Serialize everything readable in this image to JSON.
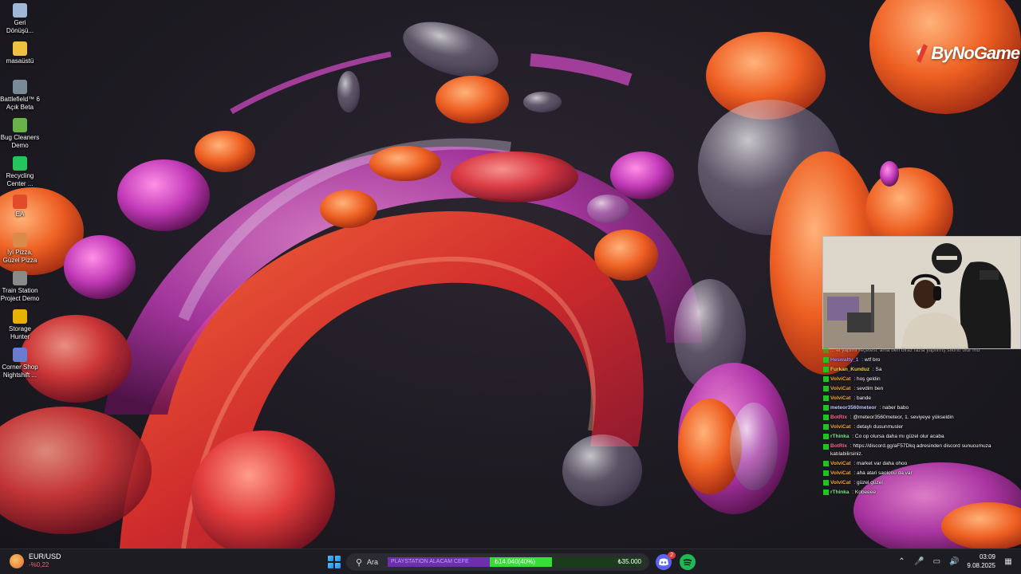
{
  "desktop": {
    "icons": [
      {
        "label": "Geri Dönüşü...",
        "icon": "recycle-bin-icon",
        "color": "#9fb8d8"
      },
      {
        "label": "masaüstü",
        "icon": "folder-icon",
        "color": "#f0c040"
      },
      {
        "label": "Battlefield™ 6 Açık Beta",
        "icon": "battlefield-icon",
        "color": "#7a8a96"
      },
      {
        "label": "Bug Cleaners Demo",
        "icon": "bug-cleaners-icon",
        "color": "#6ab04c"
      },
      {
        "label": "Recycling Center ...",
        "icon": "recycling-center-icon",
        "color": "#22c55e"
      },
      {
        "label": "EA",
        "icon": "ea-icon",
        "color": "#e24b2a"
      },
      {
        "label": "İyi Pizza, Güzel Pizza",
        "icon": "pizza-icon",
        "color": "#d98b4a"
      },
      {
        "label": "Train Station Project Demo",
        "icon": "train-station-icon",
        "color": "#8a8a8a"
      },
      {
        "label": "Storage Hunter",
        "icon": "storage-hunter-icon",
        "color": "#e6b400"
      },
      {
        "label": "Corner Shop Nightshift ...",
        "icon": "corner-shop-icon",
        "color": "#6b7bd0"
      }
    ]
  },
  "brand": {
    "text": "ByNoGame",
    "accent": "#e23b2e"
  },
  "chat": {
    "messages": [
      {
        "user": "",
        "text": "... el yapımı reçetesi. ama ben biraz fazla yapılmış sıkıntı olur mu",
        "color": "#9ad",
        "badge": "#1ec51e",
        "cut": true
      },
      {
        "user": "Heswalty_1",
        "text": "wtf bro",
        "color": "#a78bfa",
        "badge": "#1ec51e"
      },
      {
        "user": "Furkan_Kunduz",
        "text": "Sa",
        "color": "#f5d04a",
        "badge": "#1ec51e"
      },
      {
        "user": "VolviCat",
        "text": "hoş geldin",
        "color": "#f5a623",
        "badge": "#1ec51e"
      },
      {
        "user": "VolviCat",
        "text": "sevdim ben",
        "color": "#f5a623",
        "badge": "#1ec51e"
      },
      {
        "user": "VolviCat",
        "text": "bande",
        "color": "#f5a623",
        "badge": "#1ec51e"
      },
      {
        "user": "meteor3560meteor",
        "text": "naber babo",
        "color": "#b9c7ff",
        "badge": "#1ec51e"
      },
      {
        "user": "BotRix",
        "text": "@meteor3560meteor, 1. seviyeye yükseldin",
        "color": "#f76b8a",
        "badge": "#1ec51e"
      },
      {
        "user": "VolviCat",
        "text": "detaylı dusunmusler",
        "color": "#f5a623",
        "badge": "#1ec51e"
      },
      {
        "user": "rThinka",
        "text": "Co op olursa daha mı güzel olur acaba",
        "color": "#7ee787",
        "badge": "#1ec51e"
      },
      {
        "user": "BotRix",
        "text": "https://discord.gg/aF57Dkq adresinden discord sunucumuza katılabilirsiniz.",
        "color": "#f76b8a",
        "badge": "#1ec51e",
        "wrap": true
      },
      {
        "user": "VolviCat",
        "text": "market var daha ohoo",
        "color": "#f5a623",
        "badge": "#1ec51e"
      },
      {
        "user": "VolviCat",
        "text": "aha atari saolonu da var",
        "color": "#f5a623",
        "badge": "#1ec51e"
      },
      {
        "user": "VolviCat",
        "text": "güzel güzel",
        "color": "#f5a623",
        "badge": "#1ec51e"
      },
      {
        "user": "rThinka",
        "text": "Kobeeee",
        "color": "#7ee787",
        "badge": "#1ec51e"
      }
    ]
  },
  "taskbar": {
    "widget": {
      "title": "EUR/USD",
      "value": "-%0,22",
      "icon": "market-widget-icon"
    },
    "search": {
      "placeholder": "Ara",
      "banner": "PLAYSTATION ALACAM CEFE",
      "progress_left": "₺14.040(40%)",
      "progress_right": "₺35.000",
      "progress_fraction": 0.4
    },
    "apps": [
      {
        "icon": "discord-icon",
        "color": "#5865f2",
        "badge": "2"
      },
      {
        "icon": "spotify-icon",
        "color": "#1db954"
      }
    ],
    "tray": {
      "icons": [
        "chevron-up-icon",
        "microphone-icon",
        "network-icon",
        "volume-icon"
      ]
    },
    "clock": {
      "time": "03:09",
      "date": "9.08.2025"
    }
  }
}
